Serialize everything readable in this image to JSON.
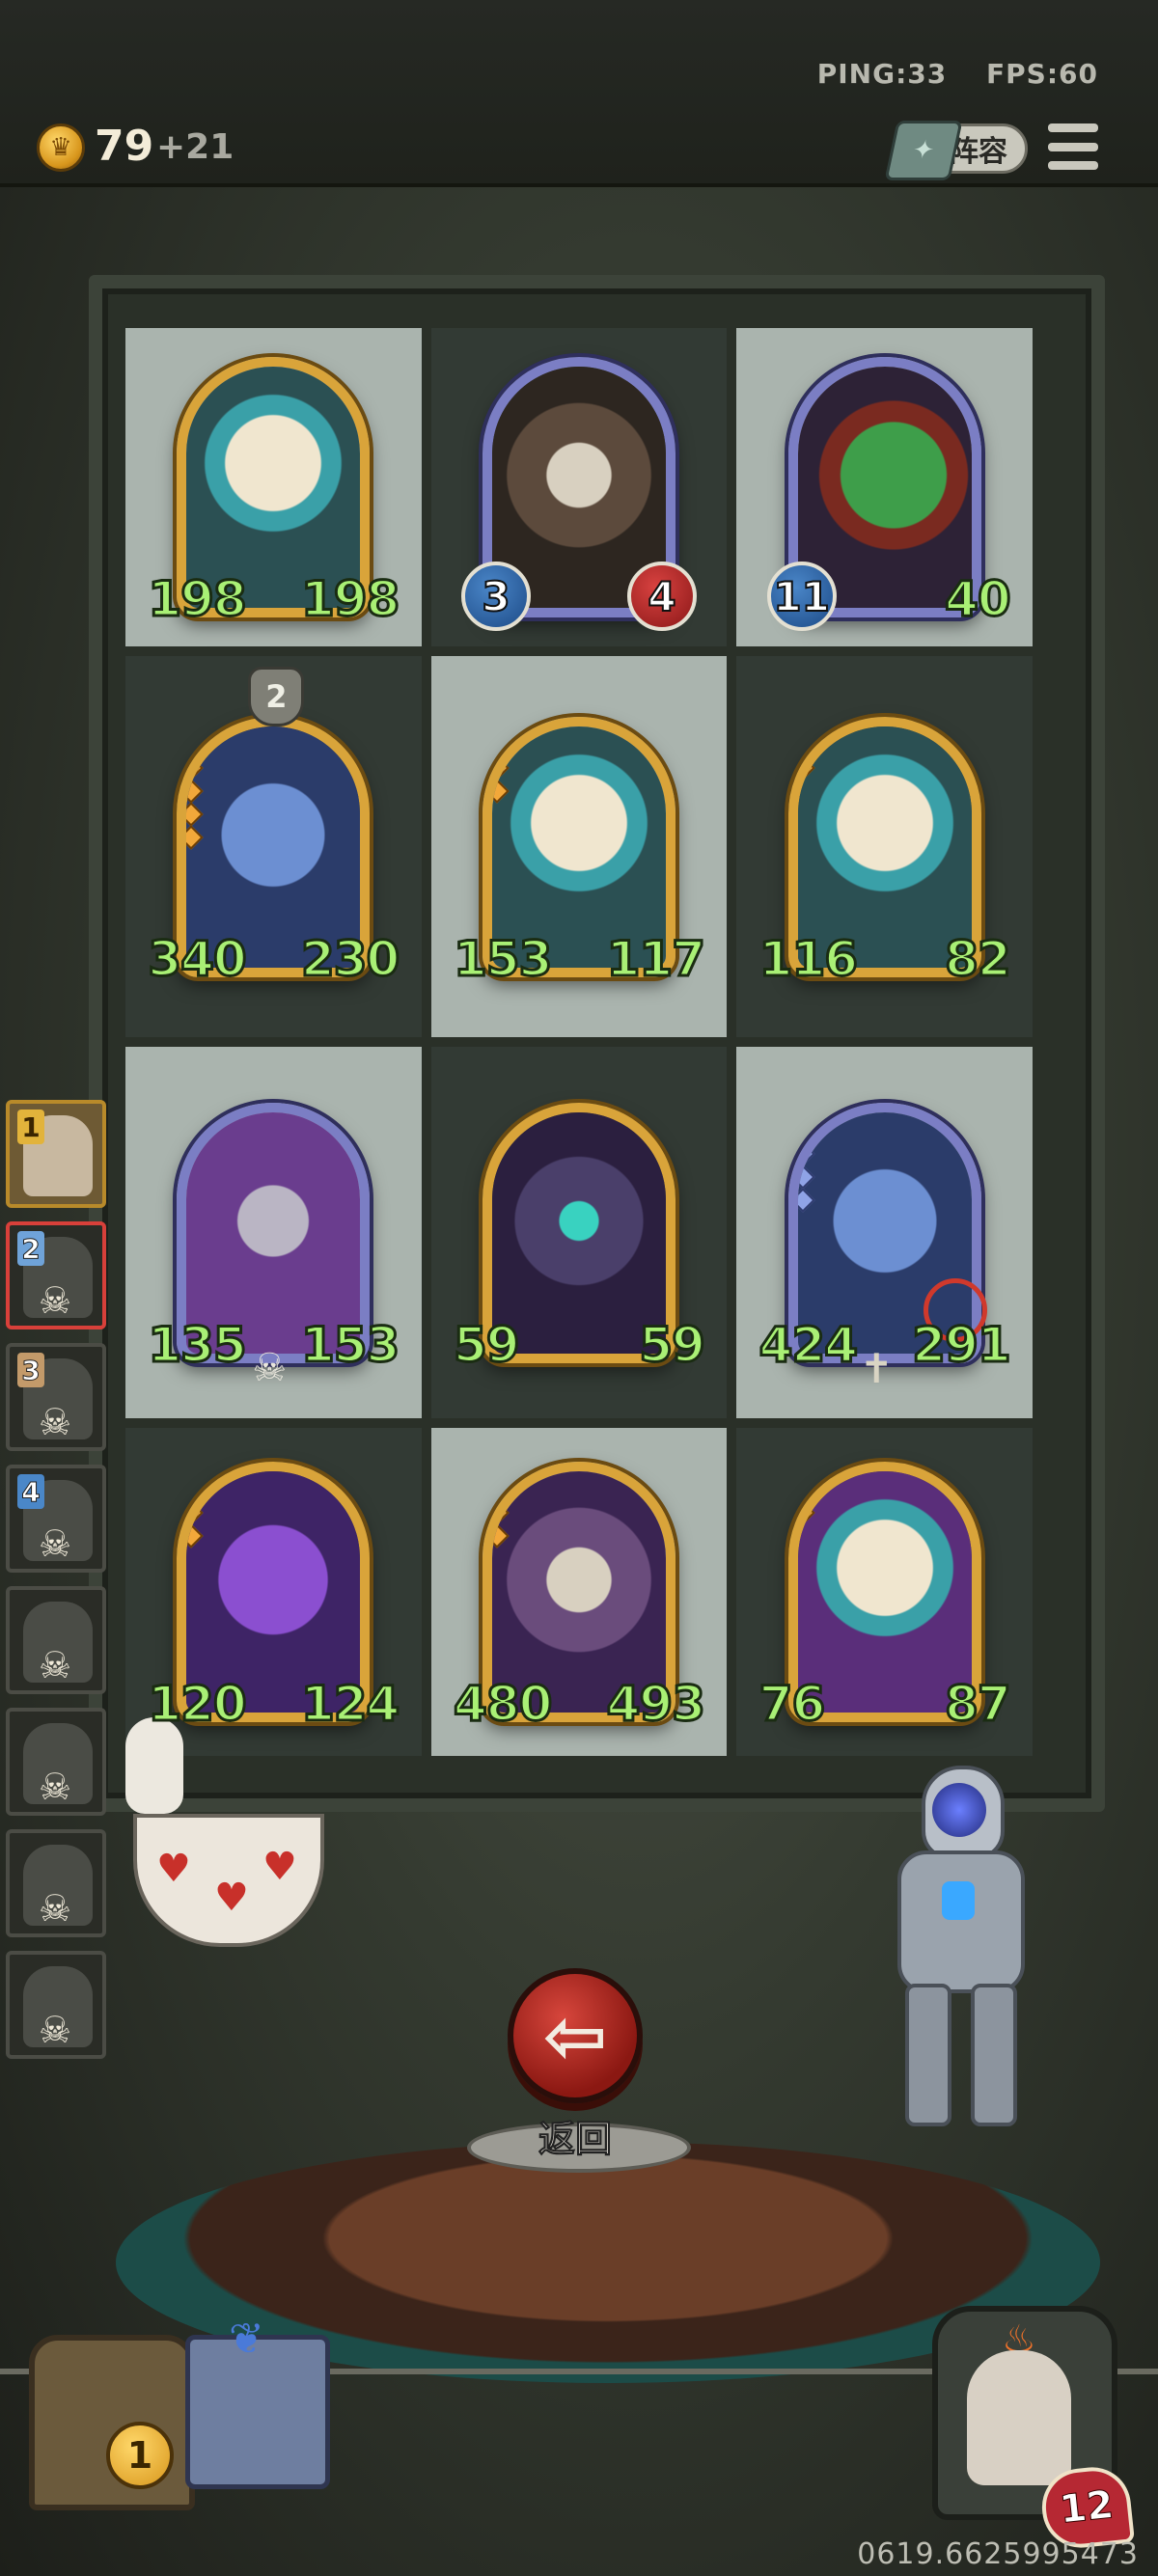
{
  "hud": {
    "ping": "PING:33",
    "fps": "FPS:60",
    "gold": "79",
    "gold_income": "+21",
    "lineup_label": "阵容",
    "bottom_code": "0619.6625995473"
  },
  "board": {
    "units": [
      {
        "name": "teal-serpent-dragon",
        "frame": "gold",
        "art": "dragon",
        "atk": "198",
        "hp": "198",
        "stars": 1,
        "style": "plain"
      },
      {
        "name": "horned-demon",
        "frame": "silver",
        "art": "demon",
        "atk": "3",
        "hp": "4",
        "stars": 0,
        "style": "orb"
      },
      {
        "name": "green-horned-croc",
        "frame": "silver",
        "art": "croc",
        "atk": "11",
        "hp": "40",
        "stars": 1,
        "style": "orb-atk"
      },
      {
        "name": "blue-toad-dragon",
        "frame": "gold",
        "art": "blue",
        "atk": "340",
        "hp": "230",
        "stars": 5,
        "style": "plain",
        "level": "2"
      },
      {
        "name": "teal-serpent-dragon",
        "frame": "gold",
        "art": "dragon",
        "atk": "153",
        "hp": "117",
        "stars": 3,
        "style": "plain"
      },
      {
        "name": "teal-serpent-dragon",
        "frame": "gold",
        "art": "dragon",
        "atk": "116",
        "hp": "82",
        "stars": 2,
        "style": "plain"
      },
      {
        "name": "horned-dragon-knight",
        "frame": "silver",
        "art": "purple",
        "atk": "135",
        "hp": "153",
        "stars": 1,
        "style": "plain",
        "marker": "skull"
      },
      {
        "name": "spectral-wraith",
        "frame": "gold",
        "art": "wraith",
        "atk": "59",
        "hp": "59",
        "stars": 0,
        "style": "plain"
      },
      {
        "name": "blue-toad-dragon",
        "frame": "silver",
        "art": "blue",
        "atk": "424",
        "hp": "291",
        "stars": 4,
        "style": "plain",
        "marker": "tomb",
        "target": true
      },
      {
        "name": "violet-dragon",
        "frame": "gold",
        "art": "violet",
        "atk": "120",
        "hp": "124",
        "stars": 3,
        "style": "plain"
      },
      {
        "name": "horned-demon",
        "frame": "gold",
        "art": "demon-p",
        "atk": "480",
        "hp": "493",
        "stars": 3,
        "style": "plain"
      },
      {
        "name": "teal-serpent-dragon",
        "frame": "gold",
        "art": "dragon-p",
        "atk": "76",
        "hp": "87",
        "stars": 2,
        "style": "plain"
      }
    ]
  },
  "roster": [
    {
      "num": "1",
      "color": "gold",
      "state": "first",
      "skull": false
    },
    {
      "num": "2",
      "color": "blue",
      "state": "current",
      "skull": true
    },
    {
      "num": "3",
      "color": "tan",
      "state": "",
      "skull": true
    },
    {
      "num": "4",
      "color": "sky",
      "state": "",
      "skull": true
    },
    {
      "num": "",
      "color": "",
      "state": "",
      "skull": true
    },
    {
      "num": "",
      "color": "",
      "state": "",
      "skull": true
    },
    {
      "num": "",
      "color": "",
      "state": "",
      "skull": true
    },
    {
      "num": "",
      "color": "",
      "state": "",
      "skull": true
    }
  ],
  "actions": {
    "back_label": "返回"
  },
  "bottom": {
    "chest_count": "1",
    "player_hp": "12"
  },
  "colors": {
    "stat_green": "#a9f075",
    "gold_frame": "#d9a43a",
    "silver_frame": "#7b7ec4",
    "back_red": "#c2312a"
  }
}
